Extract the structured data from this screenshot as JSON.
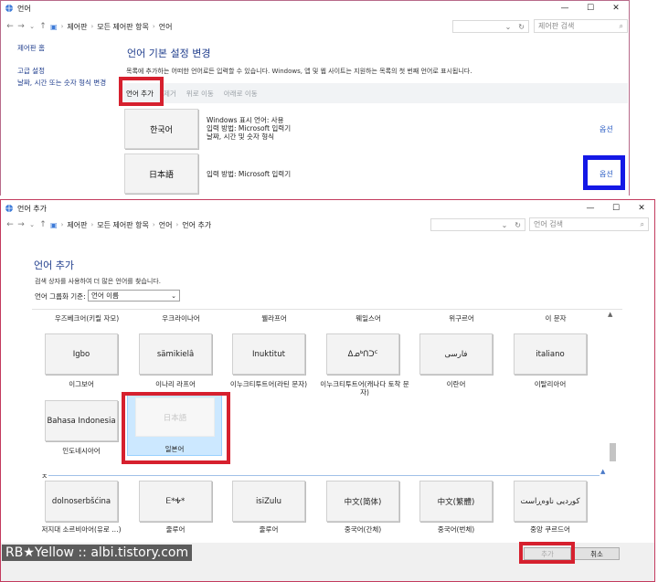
{
  "colors": {
    "highlight_red": "#d6202e",
    "highlight_blue": "#1418e6",
    "link_blue": "#2a5cc4",
    "heading_blue": "#1e3c8c"
  },
  "win1": {
    "title": "언어",
    "breadcrumbs": [
      "제어판",
      "모든 제어판 항목",
      "언어"
    ],
    "search_placeholder": "제어판 검색",
    "sidebar": {
      "home": "제어판 홈",
      "advanced": "고급 설정",
      "datetime": "날짜, 시간 또는 숫자 형식 변경"
    },
    "heading": "언어 기본 설정 변경",
    "description": "목록에 추가하는 어떠한 언어로든 입력할 수 있습니다. Windows, 앱 및 웹 사이트는 지원하는 목록의 첫 번째 언어로 표시됩니다.",
    "toolbar": {
      "add": "언어 추가",
      "remove": "제거",
      "move_up": "위로 이동",
      "move_down": "아래로 이동"
    },
    "languages": [
      {
        "name": "한국어",
        "lines": [
          "Windows 표시 언어: 사용",
          "입력 방법: Microsoft 입력기",
          "날짜, 시간 및 숫자 형식"
        ],
        "option": "옵션"
      },
      {
        "name": "日本語",
        "lines": [
          "입력 방법: Microsoft 입력기"
        ],
        "option": "옵션"
      }
    ]
  },
  "win2": {
    "title": "언어 추가",
    "breadcrumbs": [
      "제어판",
      "모든 제어판 항목",
      "언어",
      "언어 추가"
    ],
    "search_placeholder": "언어 검색",
    "heading": "언어 추가",
    "hint": "검색 상자를 사용하여 더 많은 언어를 찾습니다.",
    "group_label": "언어 그룹화 기준:",
    "group_value": "언어 이름",
    "column_headers": [
      "우즈베크어(키릴 자모)",
      "우크라이나어",
      "웰라프어",
      "웨일스어",
      "위구르어",
      "이 문자"
    ],
    "row1": [
      {
        "tile": "Igbo",
        "caption": "이그보어"
      },
      {
        "tile": "sämikielâ",
        "caption": "이나리 라프어"
      },
      {
        "tile": "Inuktitut",
        "caption": "이누크티투트어(라틴 문자)"
      },
      {
        "tile": "ᐃᓄᒃᑎᑐᑦ",
        "caption": "이누크티투트어(캐나다 토착 문자)"
      },
      {
        "tile": "فارسی",
        "caption": "이란어"
      },
      {
        "tile": "italiano",
        "caption": "이탈리아어"
      }
    ],
    "row2": [
      {
        "tile": "Bahasa Indonesia",
        "caption": "인도네시아어"
      },
      {
        "tile": "日本語",
        "caption": "일본어"
      }
    ],
    "section_letter": "ㅈ",
    "row3": [
      {
        "tile": "dolnoserbšćina",
        "caption": "저지대 소르비아어(유로 …)"
      },
      {
        "tile": "Ꭼ*Ꭽ*",
        "caption": "줄루어"
      },
      {
        "tile": "isiZulu",
        "caption": "줄루어"
      },
      {
        "tile": "中文(简体)",
        "caption": "중국어(간체)"
      },
      {
        "tile": "中文(繁體)",
        "caption": "중국어(번체)"
      },
      {
        "tile": "کوردیی ناوەڕاست",
        "caption": "중앙 쿠르드어"
      }
    ],
    "add_button": "추가",
    "cancel_button": "취소"
  },
  "watermark": "RB★Yellow :: albi.tistory.com"
}
